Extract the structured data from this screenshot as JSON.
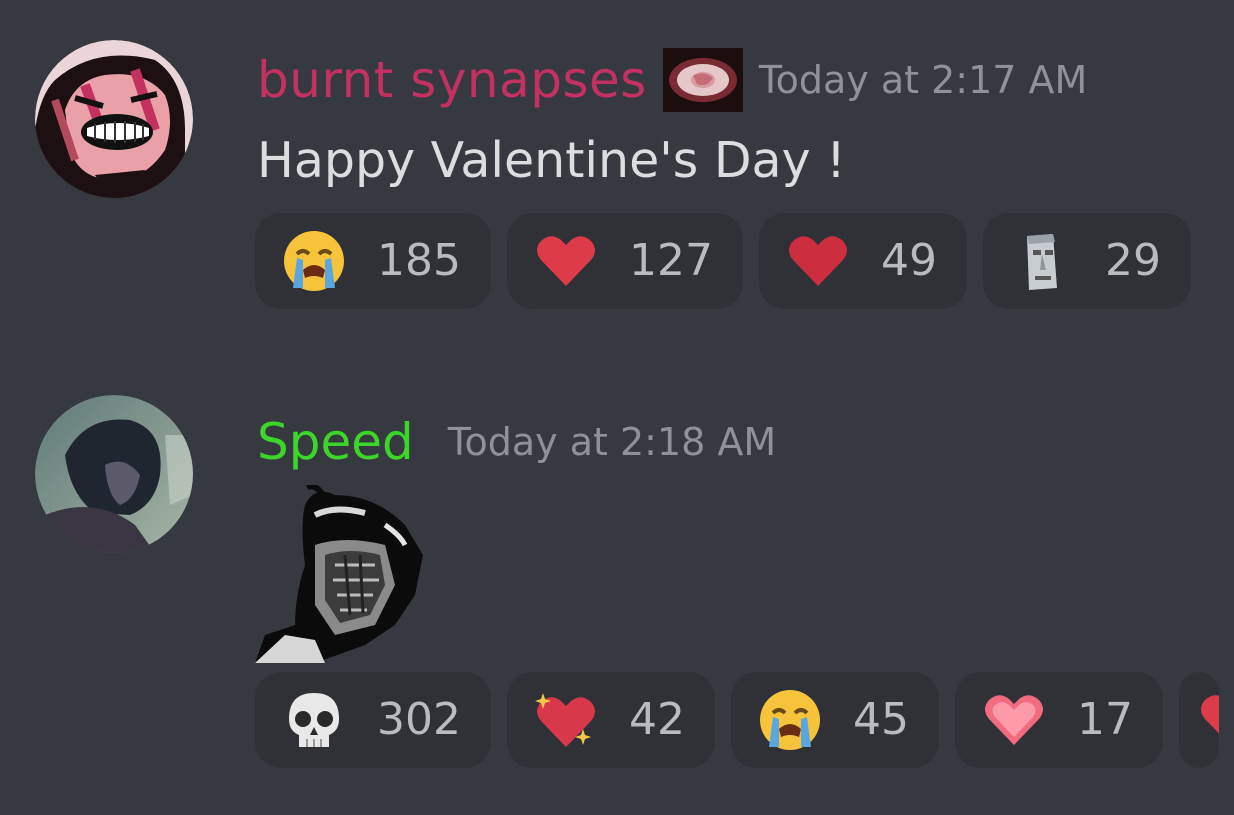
{
  "messages": [
    {
      "author": "burnt synapses",
      "author_color": "#c2315f",
      "timestamp": "Today at 2:17 AM",
      "content": "Happy Valentine's Day !",
      "reactions": [
        {
          "emoji": "loudly-crying-face",
          "count": "185"
        },
        {
          "emoji": "red-heart",
          "count": "127"
        },
        {
          "emoji": "red-heart",
          "count": "49"
        },
        {
          "emoji": "moai",
          "count": "29"
        }
      ]
    },
    {
      "author": "Speed",
      "author_color": "#3cd62b",
      "timestamp": "Today at 2:18 AM",
      "attachment": "sticker-image",
      "reactions": [
        {
          "emoji": "skull",
          "count": "302"
        },
        {
          "emoji": "sparkling-heart",
          "count": "42"
        },
        {
          "emoji": "loudly-crying-face",
          "count": "45"
        },
        {
          "emoji": "pink-heart",
          "count": "17"
        },
        {
          "emoji": "heart-partial",
          "count": ""
        }
      ]
    }
  ]
}
